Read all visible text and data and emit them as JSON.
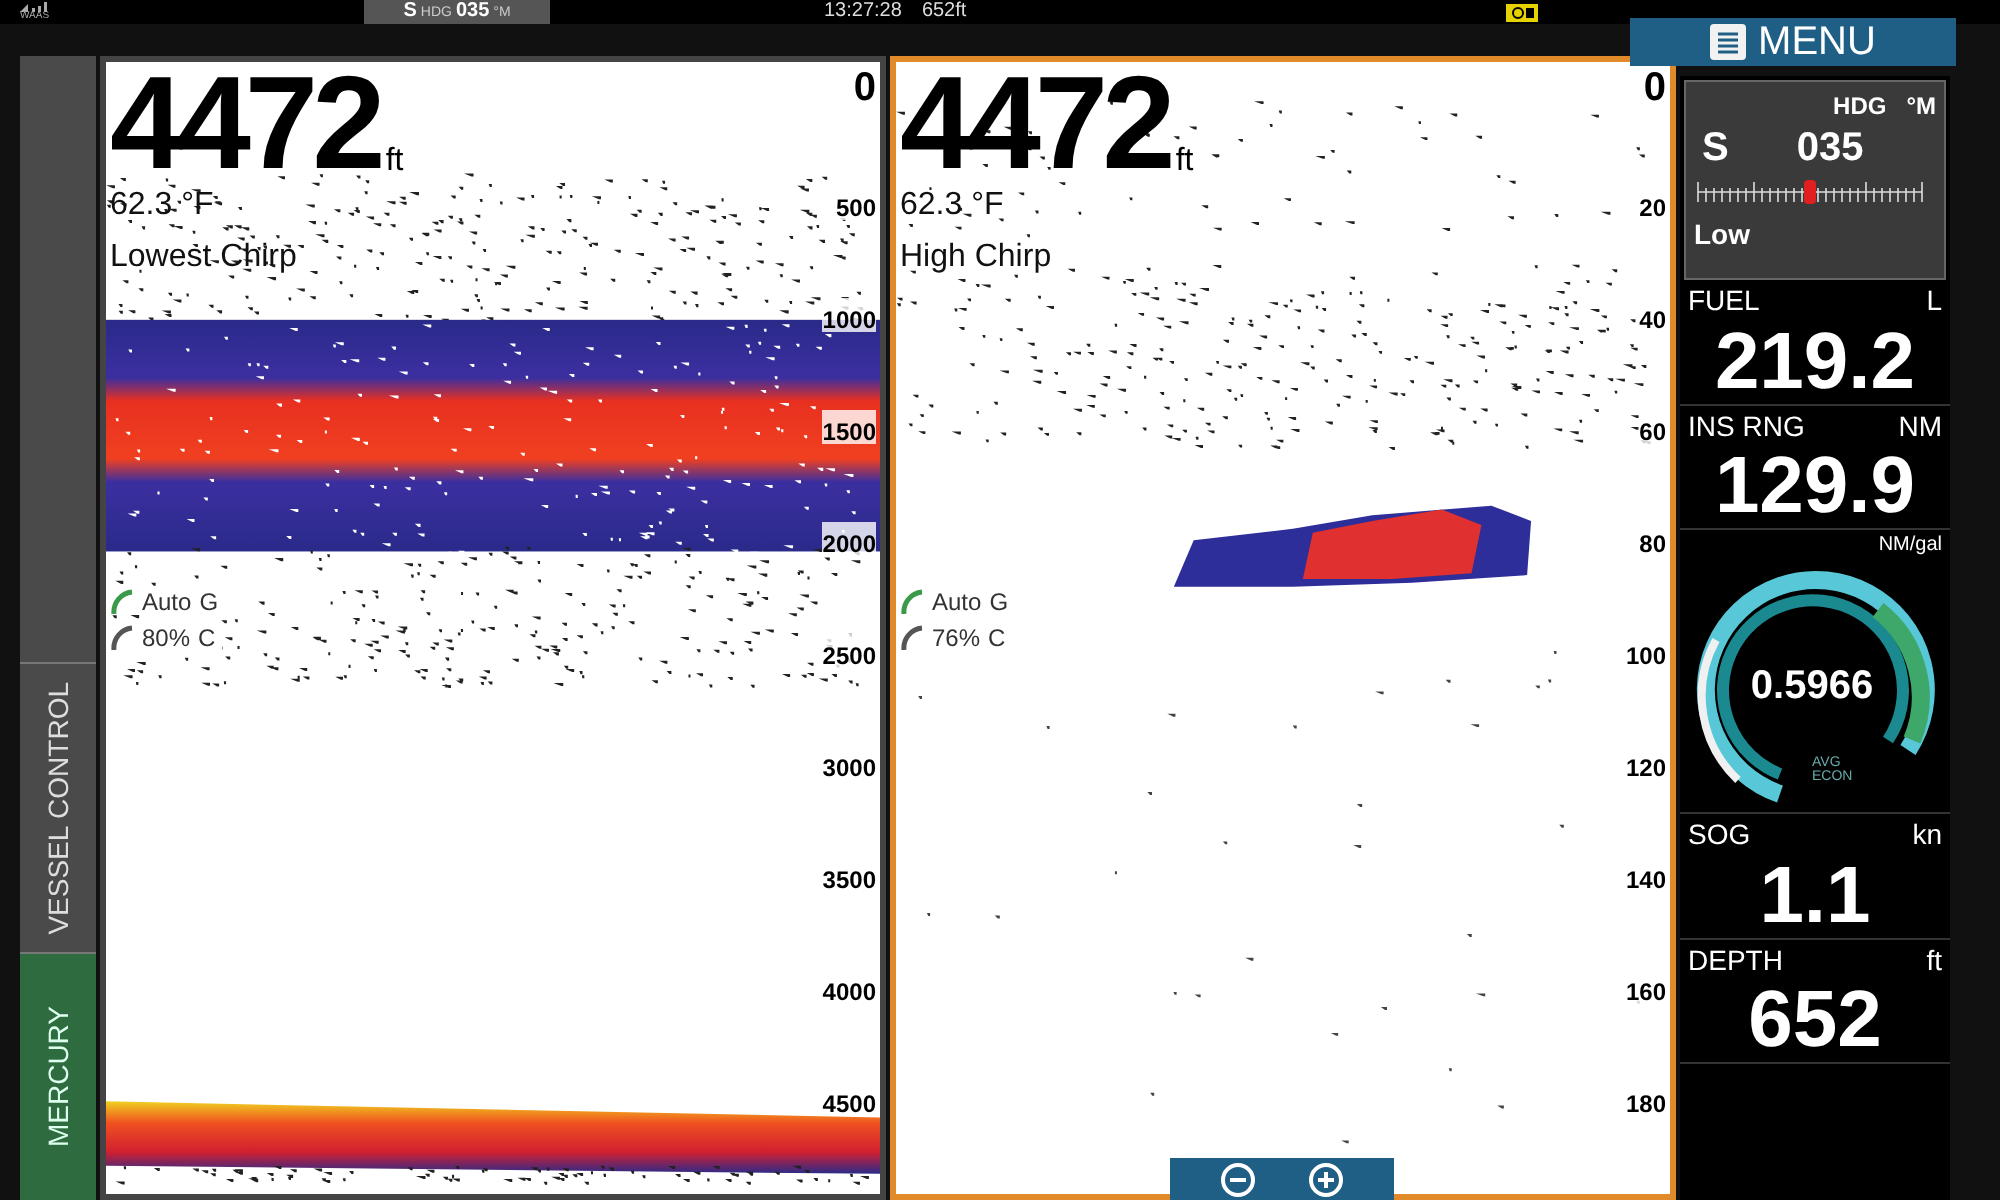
{
  "status_bar": {
    "gps_label": "WAAS",
    "heading_direction": "S",
    "heading_label": "HDG",
    "heading_value": "035",
    "heading_unit": "°M",
    "time": "13:27:28",
    "depth": "652ft"
  },
  "menu_button": {
    "label": "MENU"
  },
  "side_tabs": [
    {
      "label": "VESSEL CONTROL",
      "selected": false
    },
    {
      "label": "MERCURY",
      "selected": true
    }
  ],
  "sonar_panels": [
    {
      "depth": "4472",
      "depth_unit": "ft",
      "temperature": "62.3 °F",
      "frequency": "Lowest Chirp",
      "gain": "Auto",
      "gain_key": "G",
      "contrast": "80%",
      "contrast_key": "C",
      "selected": false,
      "scale": [
        "0",
        "500",
        "1000",
        "1500",
        "2000",
        "2500",
        "3000",
        "3500",
        "4000",
        "4500"
      ]
    },
    {
      "depth": "4472",
      "depth_unit": "ft",
      "temperature": "62.3 °F",
      "frequency": "High Chirp",
      "gain": "Auto",
      "gain_key": "G",
      "contrast": "76%",
      "contrast_key": "C",
      "selected": true,
      "scale": [
        "0",
        "20",
        "40",
        "60",
        "80",
        "100",
        "120",
        "140",
        "160",
        "180"
      ]
    }
  ],
  "instrument_panel": {
    "heading": {
      "label": "HDG",
      "unit": "°M",
      "direction": "S",
      "value": "035",
      "status": "Low"
    },
    "fields": [
      {
        "kind": "value",
        "label": "FUEL",
        "unit": "L",
        "value": "219.2"
      },
      {
        "kind": "value",
        "label": "INS RNG",
        "unit": "NM",
        "value": "129.9"
      },
      {
        "kind": "gauge",
        "unit": "NM/gal",
        "value": "0.5966",
        "caption_top": "AVG",
        "caption_bottom": "ECON"
      },
      {
        "kind": "value",
        "label": "SOG",
        "unit": "kn",
        "value": "1.1"
      },
      {
        "kind": "value",
        "label": "DEPTH",
        "unit": "ft",
        "value": "652"
      }
    ]
  }
}
